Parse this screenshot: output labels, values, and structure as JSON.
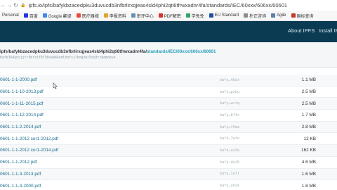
{
  "browser": {
    "url": "ipfs.io/ipfs/bafykbzacedpku3duvucdb3nfbrlirxqjeas4sld4phi2qti6tfrwxadnr4fa/standards/IEC/60xxx/606xx/60601"
  },
  "bookmarks": [
    {
      "label": "Personal",
      "icon": "none",
      "color": ""
    },
    {
      "label": "百度",
      "icon": "baidu-favicon",
      "color": "#2932e1"
    },
    {
      "label": "Google 翻译",
      "icon": "google-translate-favicon",
      "color": "#4285f4"
    },
    {
      "label": "医疗器械",
      "icon": "folder-favicon",
      "color": "#e84a3f"
    },
    {
      "label": "申报资料",
      "icon": "folder-favicon",
      "color": "#e2a52b"
    },
    {
      "label": "审评中心",
      "icon": "globe-favicon",
      "color": "#6a8fb5"
    },
    {
      "label": "PDF解密",
      "icon": "pdf-favicon",
      "color": "#d9342b"
    },
    {
      "label": "学免免",
      "icon": "site-favicon",
      "color": "#35a46b"
    },
    {
      "label": "EU Standard",
      "icon": "eu-favicon",
      "color": "#1f4fa3"
    },
    {
      "label": "朴正咨询",
      "icon": "site-favicon",
      "color": "#8b8b8b"
    },
    {
      "label": "Agile",
      "icon": "site-favicon",
      "color": "#5e7fa8"
    },
    {
      "label": "国标查询",
      "icon": "site-favicon",
      "color": "#c0392b"
    }
  ],
  "header": {
    "about_label": "About IPFS",
    "install_label": "Install IP"
  },
  "path": {
    "prefix": "ipfs/bafykbzacedpku3duvucdb3nfbrlirxqjeas4sld4phi2qti6tfrwxadnr4fa/",
    "standards": "standards/IEC/60xxx/606xx/60601",
    "cid": "bafk3k4yncjjtr3mrzif6f3boaa6kcmlhnfsjlhoqzwi5oq3rcqqmqove"
  },
  "files": [
    {
      "name": "0601-1-1-2000.pdf",
      "hash": "bafy…4bdx",
      "size": "1.1 MB"
    },
    {
      "name": "0601-1-1-10-2013.pdf",
      "hash": "bafy…pzbu",
      "size": "2.5 MB"
    },
    {
      "name": "0601-1-1-11-2015.pdf",
      "hash": "bafy…wctq",
      "size": "2.5 MB"
    },
    {
      "name": "0601-1-1-12-2014.pdf",
      "hash": "bafy…6f3c",
      "size": "1.7 MB"
    },
    {
      "name": "0601-1-1-2-2014.pdf",
      "hash": "bafy…t5ma",
      "size": "2.8 MB"
    },
    {
      "name": "0601-1-1-2012 cor1-2012.pdf",
      "hash": "bafk…7wtn",
      "size": "12 KB"
    },
    {
      "name": "0601-1-1-2012 cor1-2014.pdf",
      "hash": "bafk…ox3w",
      "size": "162 KB"
    },
    {
      "name": "0601-1-1-2012.pdf",
      "hash": "bafy…du16",
      "size": "4.6 MB"
    },
    {
      "name": "0601-1-1-3-2013.pdf",
      "hash": "bafy…lefi",
      "size": "1.6 MB"
    },
    {
      "name": "0601-1-1-4-2000.pdf",
      "hash": "bafy…ybsk",
      "size": "1.8 MB"
    }
  ]
}
